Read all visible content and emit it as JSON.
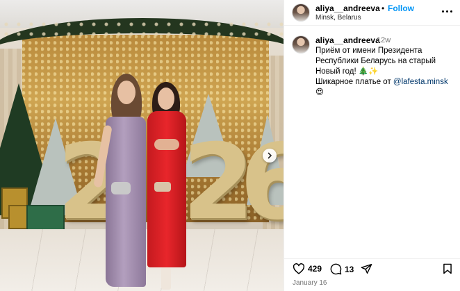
{
  "post": {
    "username": "aliya__andreeva",
    "follow_label": "Follow",
    "separator": "•",
    "location": "Minsk, Belarus",
    "caption_time": "12w",
    "caption_lines": [
      "Приём от имени Президента",
      "Республики Беларусь на старый",
      "Новый год! 🎄✨",
      "Шикарное платье от "
    ],
    "caption_mention": "@lafesta.minsk",
    "caption_tail": " 😍",
    "likes": "429",
    "comments": "13",
    "date": "January 16"
  },
  "photo": {
    "digits": [
      "2",
      "2",
      "6"
    ]
  },
  "icons": {
    "more": "more-options-icon",
    "next": "chevron-right-icon",
    "like": "heart-icon",
    "comment": "comment-bubble-icon",
    "share": "paper-plane-icon",
    "save": "bookmark-icon"
  },
  "colors": {
    "follow": "#0095f6",
    "mention": "#00376b",
    "muted": "#737373"
  }
}
